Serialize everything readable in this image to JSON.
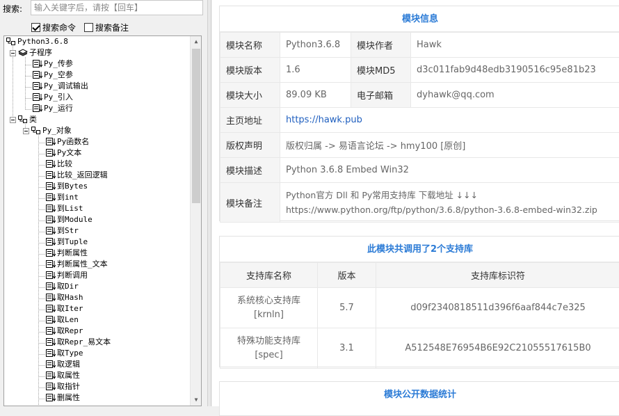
{
  "search": {
    "label": "搜索:",
    "placeholder": "输入关键字后，请按【回车】",
    "options": [
      {
        "label": "搜索命令",
        "checked": true
      },
      {
        "label": "搜索备注",
        "checked": false
      }
    ]
  },
  "tree": {
    "root": "Python3.6.8",
    "groups": [
      {
        "label": "子程序",
        "items": [
          "Py_传参",
          "Py_空参",
          "Py_调试输出",
          "Py_引入",
          "Py_运行"
        ]
      },
      {
        "label": "类",
        "class": {
          "label": "Py_对象",
          "methods": [
            "Py函数名",
            "Py文本",
            "比较",
            "比较_返回逻辑",
            "到Bytes",
            "到int",
            "到List",
            "到Module",
            "到Str",
            "到Tuple",
            "判断属性",
            "判断属性_文本",
            "判断调用",
            "取Dir",
            "取Hash",
            "取Iter",
            "取Len",
            "取Repr",
            "取Repr_易文本",
            "取Type",
            "取逻辑",
            "取属性",
            "取指针",
            "删属性"
          ]
        }
      }
    ]
  },
  "module_info": {
    "title": "模块信息",
    "rows": [
      {
        "k1": "模块名称",
        "v1": "Python3.6.8",
        "k2": "模块作者",
        "v2": "Hawk"
      },
      {
        "k1": "模块版本",
        "v1": "1.6",
        "k2": "模块MD5",
        "v2": "d3c011fab9d48edb3190516c95e81b23"
      },
      {
        "k1": "模块大小",
        "v1": "89.09 KB",
        "k2": "电子邮箱",
        "v2": "dyhawk@qq.com"
      }
    ],
    "homepage": {
      "label": "主页地址",
      "value": "https://hawk.pub"
    },
    "copyright": {
      "label": "版权声明",
      "value": "版权归属 -> 易语言论坛 -> hmy100 [原创]"
    },
    "description": {
      "label": "模块描述",
      "value": "Python 3.6.8 Embed Win32"
    },
    "remark": {
      "label": "模块备注",
      "line1": "Python官方 Dll 和 Py常用支持库 下载地址 ↓↓↓",
      "line2": "https://www.python.org/ftp/python/3.6.8/python-3.6.8-embed-win32.zip"
    }
  },
  "support_libs": {
    "title": "此模块共调用了2个支持库",
    "headers": [
      "支持库名称",
      "版本",
      "支持库标识符"
    ],
    "rows": [
      {
        "name": "系统核心支持库",
        "code": "[krnln]",
        "version": "5.7",
        "id": "d09f2340818511d396f6aaf844c7e325"
      },
      {
        "name": "特殊功能支持库",
        "code": "[spec]",
        "version": "3.1",
        "id": "A512548E76954B6E92C21055517615B0"
      }
    ]
  },
  "stats": {
    "title": "模块公开数据统计"
  },
  "colors": {
    "accent": "#2b7bd6",
    "link": "#1f5fbf"
  }
}
